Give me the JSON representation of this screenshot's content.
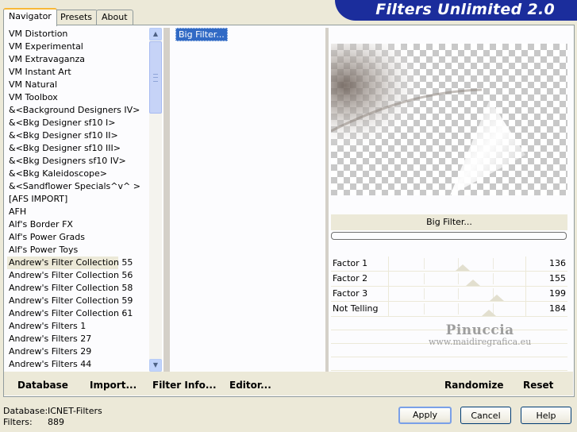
{
  "tabs": [
    "Navigator",
    "Presets",
    "About"
  ],
  "brand": "Filters Unlimited 2.0",
  "categories": [
    "VM Distortion",
    "VM Experimental",
    "VM Extravaganza",
    "VM Instant Art",
    "VM Natural",
    "VM Toolbox",
    "&<Background Designers IV>",
    "&<Bkg Designer sf10 I>",
    "&<Bkg Designer sf10 II>",
    "&<Bkg Designer sf10 III>",
    "&<Bkg Designers sf10 IV>",
    "&<Bkg Kaleidoscope>",
    "&<Sandflower Specials^v^ >",
    "[AFS IMPORT]",
    "AFH",
    "Alf's Border FX",
    "Alf's Power Grads",
    "Alf's Power Toys",
    "Andrew's Filter Collection 55",
    "Andrew's Filter Collection 56",
    "Andrew's Filter Collection 58",
    "Andrew's Filter Collection 59",
    "Andrew's Filter Collection 61",
    "Andrew's Filters 1",
    "Andrew's Filters 27",
    "Andrew's Filters 29",
    "Andrew's Filters 44"
  ],
  "selected_category_index": 18,
  "filter_selected": "Big Filter...",
  "preview_label": "Big Filter...",
  "factors": [
    {
      "label": "Factor 1",
      "value": "136",
      "fraction": 0.533
    },
    {
      "label": "Factor 2",
      "value": "155",
      "fraction": 0.608
    },
    {
      "label": "Factor 3",
      "value": "199",
      "fraction": 0.78
    },
    {
      "label": "Not Telling",
      "value": "184",
      "fraction": 0.722
    }
  ],
  "watermark": {
    "line1": "Pinuccia",
    "line2": "www.maidiregrafica.eu"
  },
  "bottom_buttons": {
    "database": "Database",
    "import": "Import...",
    "filter_info": "Filter Info...",
    "editor": "Editor...",
    "randomize": "Randomize",
    "reset": "Reset"
  },
  "status": {
    "database_label": "Database:",
    "database_value": "ICNET-Filters",
    "filters_label": "Filters:",
    "filters_value": "889"
  },
  "dialog_buttons": {
    "apply": "Apply",
    "cancel": "Cancel",
    "help": "Help"
  }
}
